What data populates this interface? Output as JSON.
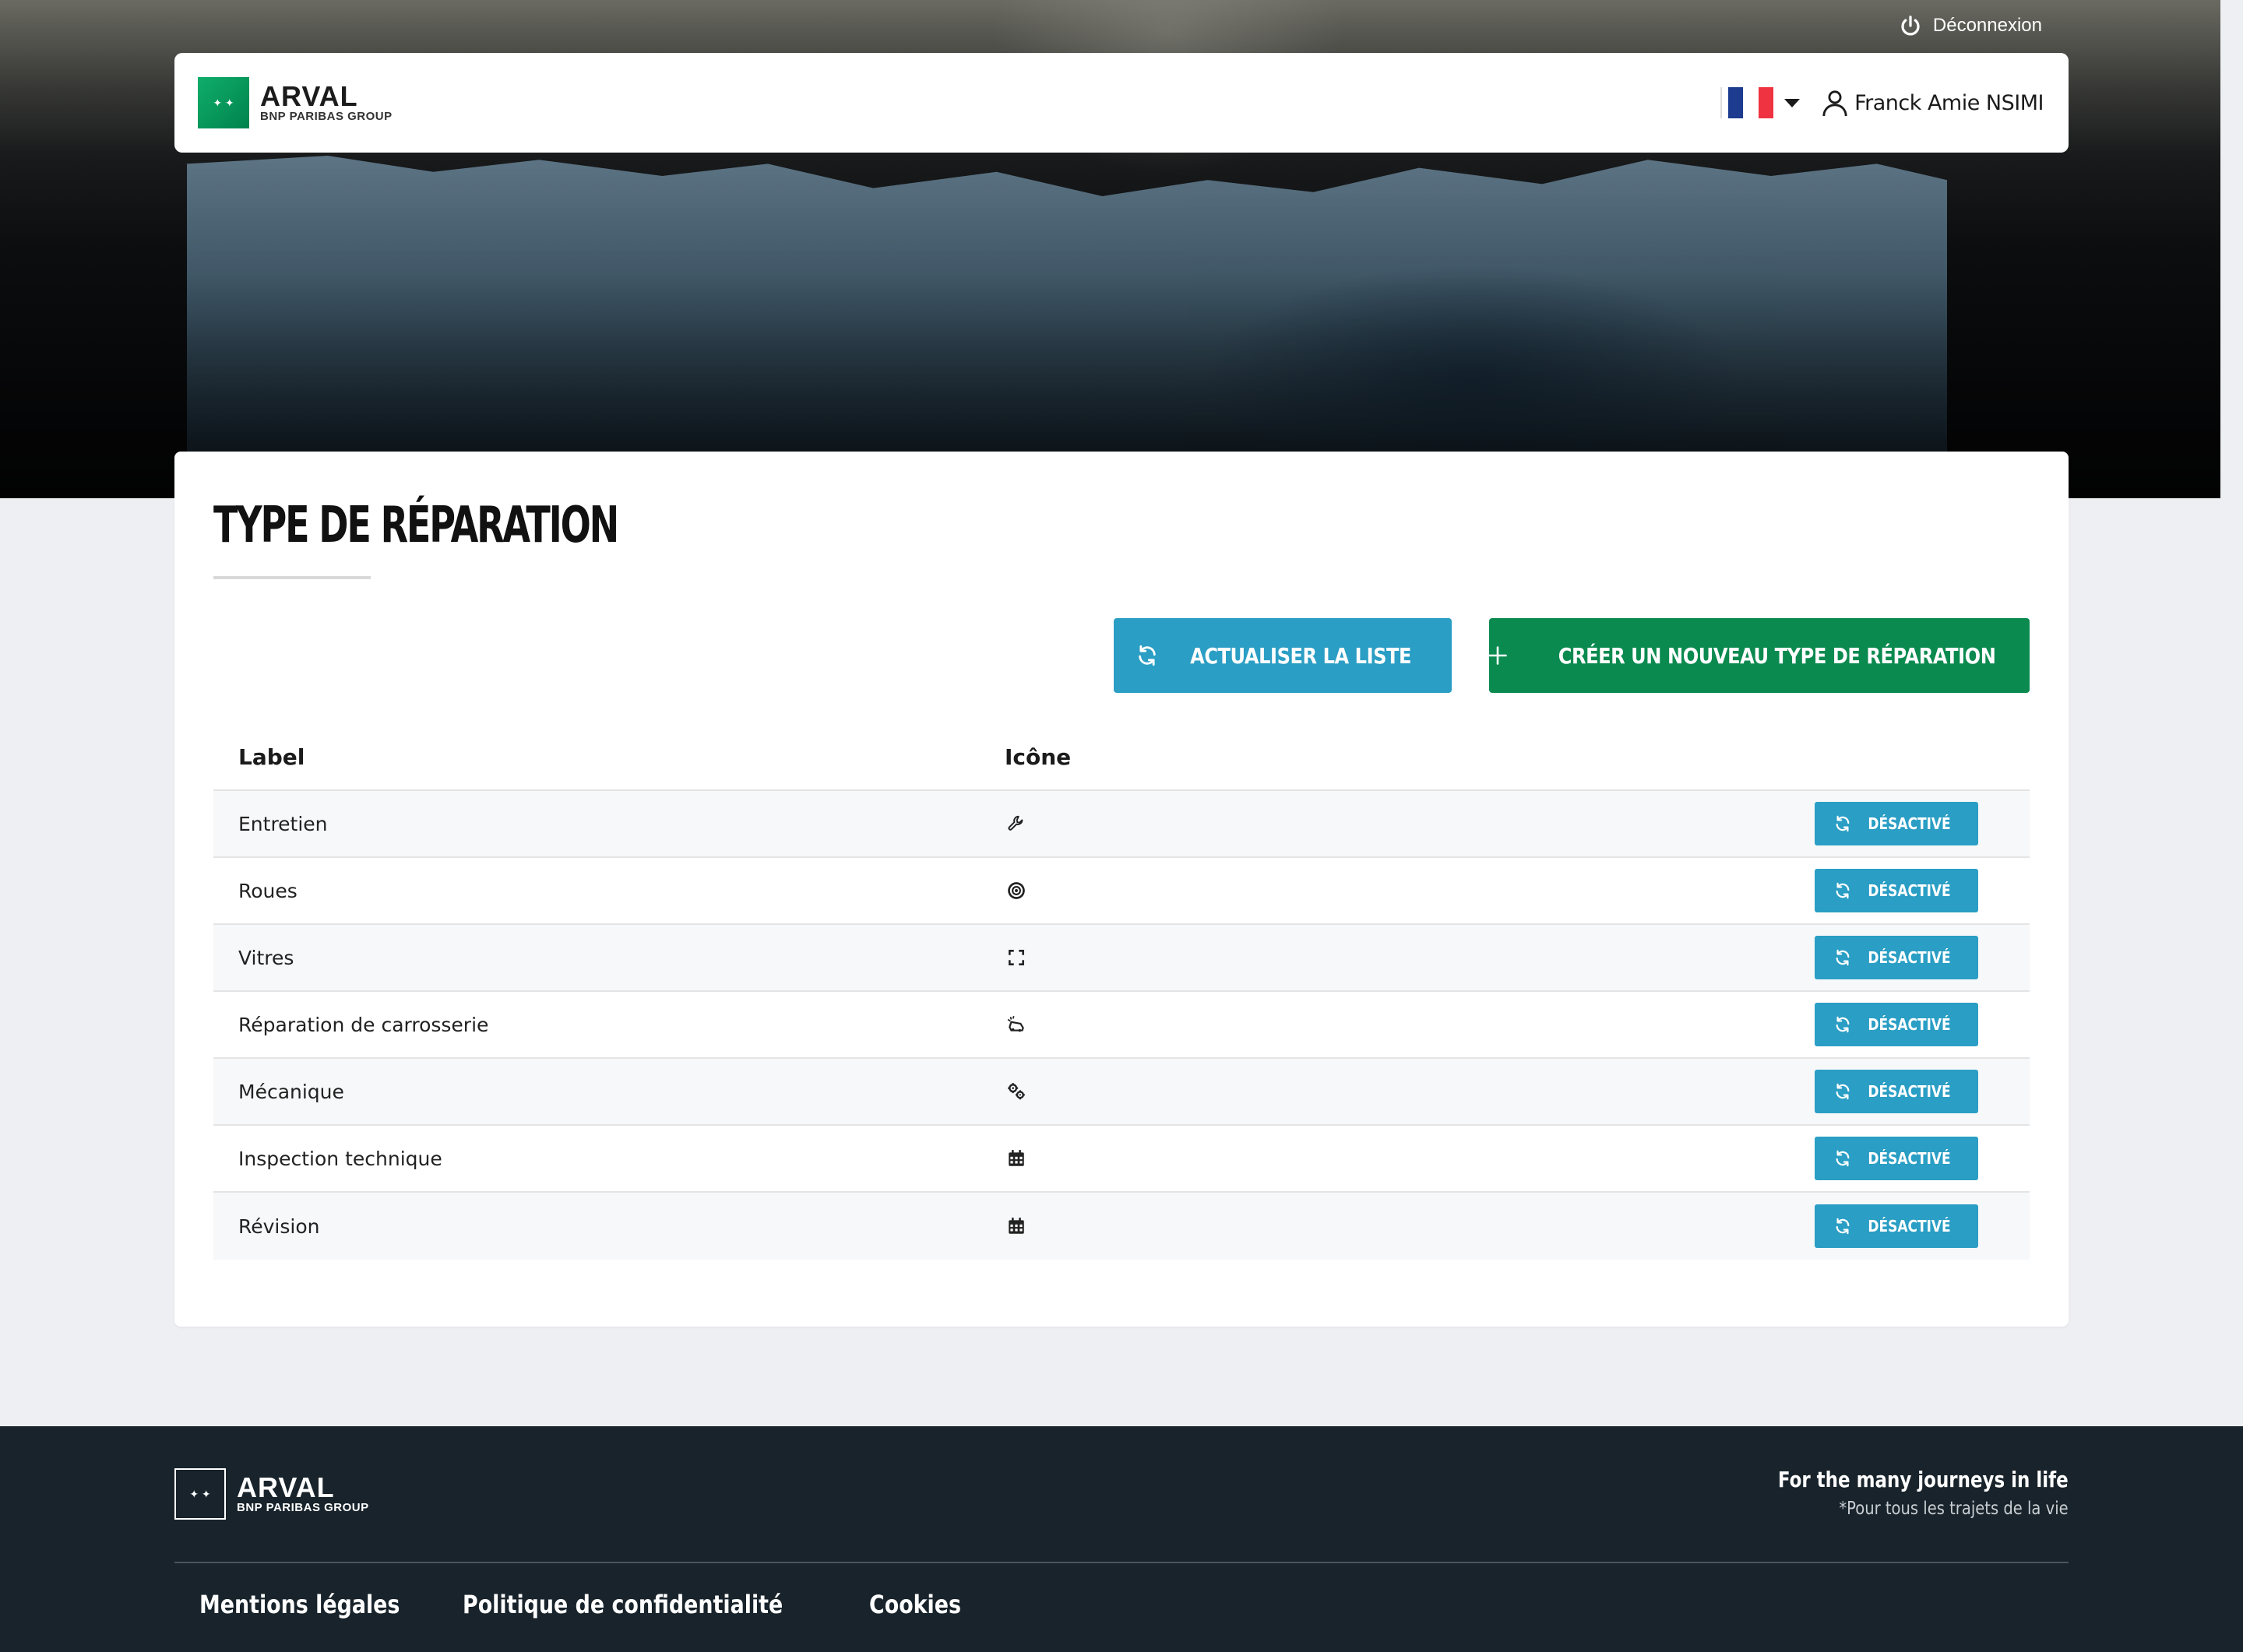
{
  "topbar": {
    "logout_label": "Déconnexion",
    "logout_icon": "power-icon"
  },
  "header": {
    "brand_name": "ARVAL",
    "brand_group": "BNP PARIBAS GROUP",
    "language_flag": "fr-flag",
    "user_name": "Franck Amie NSIMI",
    "user_icon": "user-icon"
  },
  "page": {
    "title": "TYPE DE RÉPARATION",
    "refresh_label": "ACTUALISER LA LISTE",
    "create_label": "CRÉER UN NOUVEAU TYPE DE RÉPARATION"
  },
  "table": {
    "columns": [
      "Label",
      "Icône"
    ],
    "rows": [
      {
        "label": "Entretien",
        "icon": "wrench-icon",
        "status": "DÉSACTIVÉ"
      },
      {
        "label": "Roues",
        "icon": "target-icon",
        "status": "DÉSACTIVÉ"
      },
      {
        "label": "Vitres",
        "icon": "expand-icon",
        "status": "DÉSACTIVÉ"
      },
      {
        "label": "Réparation de carrosserie",
        "icon": "car-crash-icon",
        "status": "DÉSACTIVÉ"
      },
      {
        "label": "Mécanique",
        "icon": "cogs-icon",
        "status": "DÉSACTIVÉ"
      },
      {
        "label": "Inspection technique",
        "icon": "calendar-icon",
        "status": "DÉSACTIVÉ"
      },
      {
        "label": "Révision",
        "icon": "calendar-icon",
        "status": "DÉSACTIVÉ"
      }
    ]
  },
  "footer": {
    "brand_name": "ARVAL",
    "brand_group": "BNP PARIBAS GROUP",
    "tagline": "For the many journeys in life",
    "tagline_sub": "*Pour tous les trajets de la vie",
    "links": [
      "Mentions légales",
      "Politique de confidentialité",
      "Cookies"
    ]
  },
  "colors": {
    "primary_blue": "#2a9ec4",
    "primary_green": "#0a8a4f",
    "footer_bg": "#18232b",
    "page_bg": "#eeeff2"
  }
}
